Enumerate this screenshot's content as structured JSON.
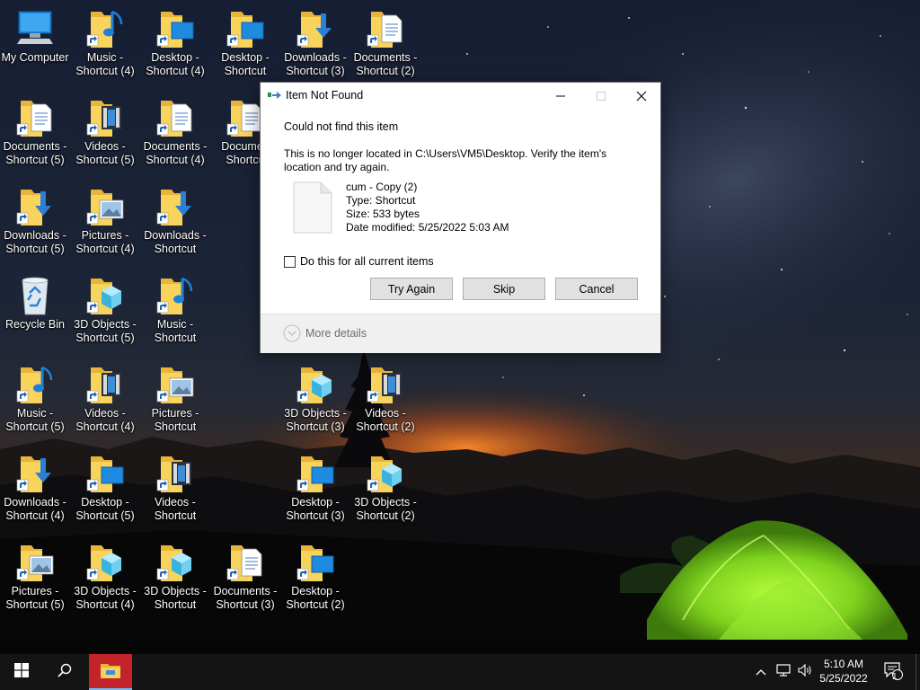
{
  "desktop": {
    "icons": [
      {
        "label1": "My Computer",
        "label2": "",
        "type": "computer"
      },
      {
        "label1": "Music -",
        "label2": "Shortcut (4)",
        "type": "music"
      },
      {
        "label1": "Desktop -",
        "label2": "Shortcut (4)",
        "type": "desktop"
      },
      {
        "label1": "Desktop -",
        "label2": "Shortcut",
        "type": "desktop"
      },
      {
        "label1": "Downloads -",
        "label2": "Shortcut (3)",
        "type": "downloads"
      },
      {
        "label1": "Documents -",
        "label2": "Shortcut (2)",
        "type": "documents"
      },
      {
        "label1": "Documents -",
        "label2": "Shortcut (5)",
        "type": "documents"
      },
      {
        "label1": "Videos -",
        "label2": "Shortcut (5)",
        "type": "videos"
      },
      {
        "label1": "Documents -",
        "label2": "Shortcut (4)",
        "type": "documents"
      },
      {
        "label1": "Documen",
        "label2": "Shortcu",
        "type": "documents"
      },
      {
        "label1": "Downloads -",
        "label2": "Shortcut (5)",
        "type": "downloads"
      },
      {
        "label1": "Pictures -",
        "label2": "Shortcut (4)",
        "type": "pictures"
      },
      {
        "label1": "Downloads -",
        "label2": "Shortcut",
        "type": "downloads"
      },
      {
        "label1": "Recycle Bin",
        "label2": "",
        "type": "recycle"
      },
      {
        "label1": "3D Objects -",
        "label2": "Shortcut (5)",
        "type": "objects3d"
      },
      {
        "label1": "Music -",
        "label2": "Shortcut",
        "type": "music"
      },
      {
        "label1": "Music -",
        "label2": "Shortcut (5)",
        "type": "music"
      },
      {
        "label1": "Videos -",
        "label2": "Shortcut (4)",
        "type": "videos"
      },
      {
        "label1": "Pictures -",
        "label2": "Shortcut",
        "type": "pictures"
      },
      {
        "label1": "3D Objects -",
        "label2": "Shortcut (3)",
        "type": "objects3d"
      },
      {
        "label1": "Videos -",
        "label2": "Shortcut (2)",
        "type": "videos"
      },
      {
        "label1": "Downloads -",
        "label2": "Shortcut (4)",
        "type": "downloads"
      },
      {
        "label1": "Desktop -",
        "label2": "Shortcut (5)",
        "type": "desktop"
      },
      {
        "label1": "Videos -",
        "label2": "Shortcut",
        "type": "videos"
      },
      {
        "label1": "Desktop -",
        "label2": "Shortcut (3)",
        "type": "desktop"
      },
      {
        "label1": "3D Objects -",
        "label2": "Shortcut (2)",
        "type": "objects3d"
      },
      {
        "label1": "Pictures -",
        "label2": "Shortcut (5)",
        "type": "pictures"
      },
      {
        "label1": "3D Objects -",
        "label2": "Shortcut (4)",
        "type": "objects3d"
      },
      {
        "label1": "3D Objects -",
        "label2": "Shortcut",
        "type": "objects3d"
      },
      {
        "label1": "Documents -",
        "label2": "Shortcut (3)",
        "type": "documents"
      },
      {
        "label1": "Desktop -",
        "label2": "Shortcut (2)",
        "type": "desktop"
      }
    ]
  },
  "dialog": {
    "title": "Item Not Found",
    "heading": "Could not find this item",
    "message": "This is no longer located in C:\\Users\\VM5\\Desktop. Verify the item's location and try again.",
    "file": {
      "name": "cum - Copy (2)",
      "type": "Type: Shortcut",
      "size": "Size: 533 bytes",
      "modified": "Date modified: 5/25/2022 5:03 AM"
    },
    "checkbox_label": "Do this for all current items",
    "checkbox_checked": false,
    "buttons": {
      "try_again": "Try Again",
      "skip": "Skip",
      "cancel": "Cancel"
    },
    "more_details": "More details"
  },
  "taskbar": {
    "time": "5:10 AM",
    "date": "5/25/2022",
    "notification_count": "1",
    "active_app_color": "#c2242a"
  }
}
